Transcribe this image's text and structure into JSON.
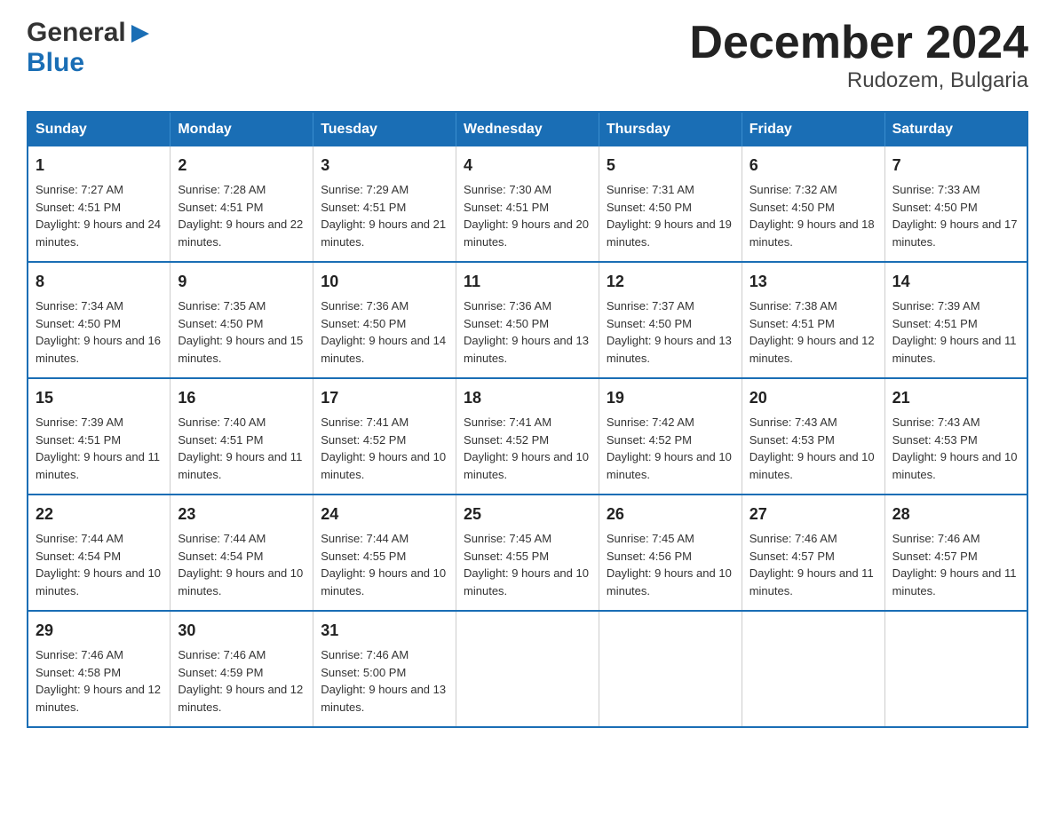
{
  "header": {
    "logo_general": "General",
    "logo_blue": "Blue",
    "title": "December 2024",
    "subtitle": "Rudozem, Bulgaria"
  },
  "calendar": {
    "days_of_week": [
      "Sunday",
      "Monday",
      "Tuesday",
      "Wednesday",
      "Thursday",
      "Friday",
      "Saturday"
    ],
    "weeks": [
      [
        {
          "day": "1",
          "sunrise": "Sunrise: 7:27 AM",
          "sunset": "Sunset: 4:51 PM",
          "daylight": "Daylight: 9 hours and 24 minutes."
        },
        {
          "day": "2",
          "sunrise": "Sunrise: 7:28 AM",
          "sunset": "Sunset: 4:51 PM",
          "daylight": "Daylight: 9 hours and 22 minutes."
        },
        {
          "day": "3",
          "sunrise": "Sunrise: 7:29 AM",
          "sunset": "Sunset: 4:51 PM",
          "daylight": "Daylight: 9 hours and 21 minutes."
        },
        {
          "day": "4",
          "sunrise": "Sunrise: 7:30 AM",
          "sunset": "Sunset: 4:51 PM",
          "daylight": "Daylight: 9 hours and 20 minutes."
        },
        {
          "day": "5",
          "sunrise": "Sunrise: 7:31 AM",
          "sunset": "Sunset: 4:50 PM",
          "daylight": "Daylight: 9 hours and 19 minutes."
        },
        {
          "day": "6",
          "sunrise": "Sunrise: 7:32 AM",
          "sunset": "Sunset: 4:50 PM",
          "daylight": "Daylight: 9 hours and 18 minutes."
        },
        {
          "day": "7",
          "sunrise": "Sunrise: 7:33 AM",
          "sunset": "Sunset: 4:50 PM",
          "daylight": "Daylight: 9 hours and 17 minutes."
        }
      ],
      [
        {
          "day": "8",
          "sunrise": "Sunrise: 7:34 AM",
          "sunset": "Sunset: 4:50 PM",
          "daylight": "Daylight: 9 hours and 16 minutes."
        },
        {
          "day": "9",
          "sunrise": "Sunrise: 7:35 AM",
          "sunset": "Sunset: 4:50 PM",
          "daylight": "Daylight: 9 hours and 15 minutes."
        },
        {
          "day": "10",
          "sunrise": "Sunrise: 7:36 AM",
          "sunset": "Sunset: 4:50 PM",
          "daylight": "Daylight: 9 hours and 14 minutes."
        },
        {
          "day": "11",
          "sunrise": "Sunrise: 7:36 AM",
          "sunset": "Sunset: 4:50 PM",
          "daylight": "Daylight: 9 hours and 13 minutes."
        },
        {
          "day": "12",
          "sunrise": "Sunrise: 7:37 AM",
          "sunset": "Sunset: 4:50 PM",
          "daylight": "Daylight: 9 hours and 13 minutes."
        },
        {
          "day": "13",
          "sunrise": "Sunrise: 7:38 AM",
          "sunset": "Sunset: 4:51 PM",
          "daylight": "Daylight: 9 hours and 12 minutes."
        },
        {
          "day": "14",
          "sunrise": "Sunrise: 7:39 AM",
          "sunset": "Sunset: 4:51 PM",
          "daylight": "Daylight: 9 hours and 11 minutes."
        }
      ],
      [
        {
          "day": "15",
          "sunrise": "Sunrise: 7:39 AM",
          "sunset": "Sunset: 4:51 PM",
          "daylight": "Daylight: 9 hours and 11 minutes."
        },
        {
          "day": "16",
          "sunrise": "Sunrise: 7:40 AM",
          "sunset": "Sunset: 4:51 PM",
          "daylight": "Daylight: 9 hours and 11 minutes."
        },
        {
          "day": "17",
          "sunrise": "Sunrise: 7:41 AM",
          "sunset": "Sunset: 4:52 PM",
          "daylight": "Daylight: 9 hours and 10 minutes."
        },
        {
          "day": "18",
          "sunrise": "Sunrise: 7:41 AM",
          "sunset": "Sunset: 4:52 PM",
          "daylight": "Daylight: 9 hours and 10 minutes."
        },
        {
          "day": "19",
          "sunrise": "Sunrise: 7:42 AM",
          "sunset": "Sunset: 4:52 PM",
          "daylight": "Daylight: 9 hours and 10 minutes."
        },
        {
          "day": "20",
          "sunrise": "Sunrise: 7:43 AM",
          "sunset": "Sunset: 4:53 PM",
          "daylight": "Daylight: 9 hours and 10 minutes."
        },
        {
          "day": "21",
          "sunrise": "Sunrise: 7:43 AM",
          "sunset": "Sunset: 4:53 PM",
          "daylight": "Daylight: 9 hours and 10 minutes."
        }
      ],
      [
        {
          "day": "22",
          "sunrise": "Sunrise: 7:44 AM",
          "sunset": "Sunset: 4:54 PM",
          "daylight": "Daylight: 9 hours and 10 minutes."
        },
        {
          "day": "23",
          "sunrise": "Sunrise: 7:44 AM",
          "sunset": "Sunset: 4:54 PM",
          "daylight": "Daylight: 9 hours and 10 minutes."
        },
        {
          "day": "24",
          "sunrise": "Sunrise: 7:44 AM",
          "sunset": "Sunset: 4:55 PM",
          "daylight": "Daylight: 9 hours and 10 minutes."
        },
        {
          "day": "25",
          "sunrise": "Sunrise: 7:45 AM",
          "sunset": "Sunset: 4:55 PM",
          "daylight": "Daylight: 9 hours and 10 minutes."
        },
        {
          "day": "26",
          "sunrise": "Sunrise: 7:45 AM",
          "sunset": "Sunset: 4:56 PM",
          "daylight": "Daylight: 9 hours and 10 minutes."
        },
        {
          "day": "27",
          "sunrise": "Sunrise: 7:46 AM",
          "sunset": "Sunset: 4:57 PM",
          "daylight": "Daylight: 9 hours and 11 minutes."
        },
        {
          "day": "28",
          "sunrise": "Sunrise: 7:46 AM",
          "sunset": "Sunset: 4:57 PM",
          "daylight": "Daylight: 9 hours and 11 minutes."
        }
      ],
      [
        {
          "day": "29",
          "sunrise": "Sunrise: 7:46 AM",
          "sunset": "Sunset: 4:58 PM",
          "daylight": "Daylight: 9 hours and 12 minutes."
        },
        {
          "day": "30",
          "sunrise": "Sunrise: 7:46 AM",
          "sunset": "Sunset: 4:59 PM",
          "daylight": "Daylight: 9 hours and 12 minutes."
        },
        {
          "day": "31",
          "sunrise": "Sunrise: 7:46 AM",
          "sunset": "Sunset: 5:00 PM",
          "daylight": "Daylight: 9 hours and 13 minutes."
        },
        {
          "day": "",
          "sunrise": "",
          "sunset": "",
          "daylight": ""
        },
        {
          "day": "",
          "sunrise": "",
          "sunset": "",
          "daylight": ""
        },
        {
          "day": "",
          "sunrise": "",
          "sunset": "",
          "daylight": ""
        },
        {
          "day": "",
          "sunrise": "",
          "sunset": "",
          "daylight": ""
        }
      ]
    ]
  }
}
